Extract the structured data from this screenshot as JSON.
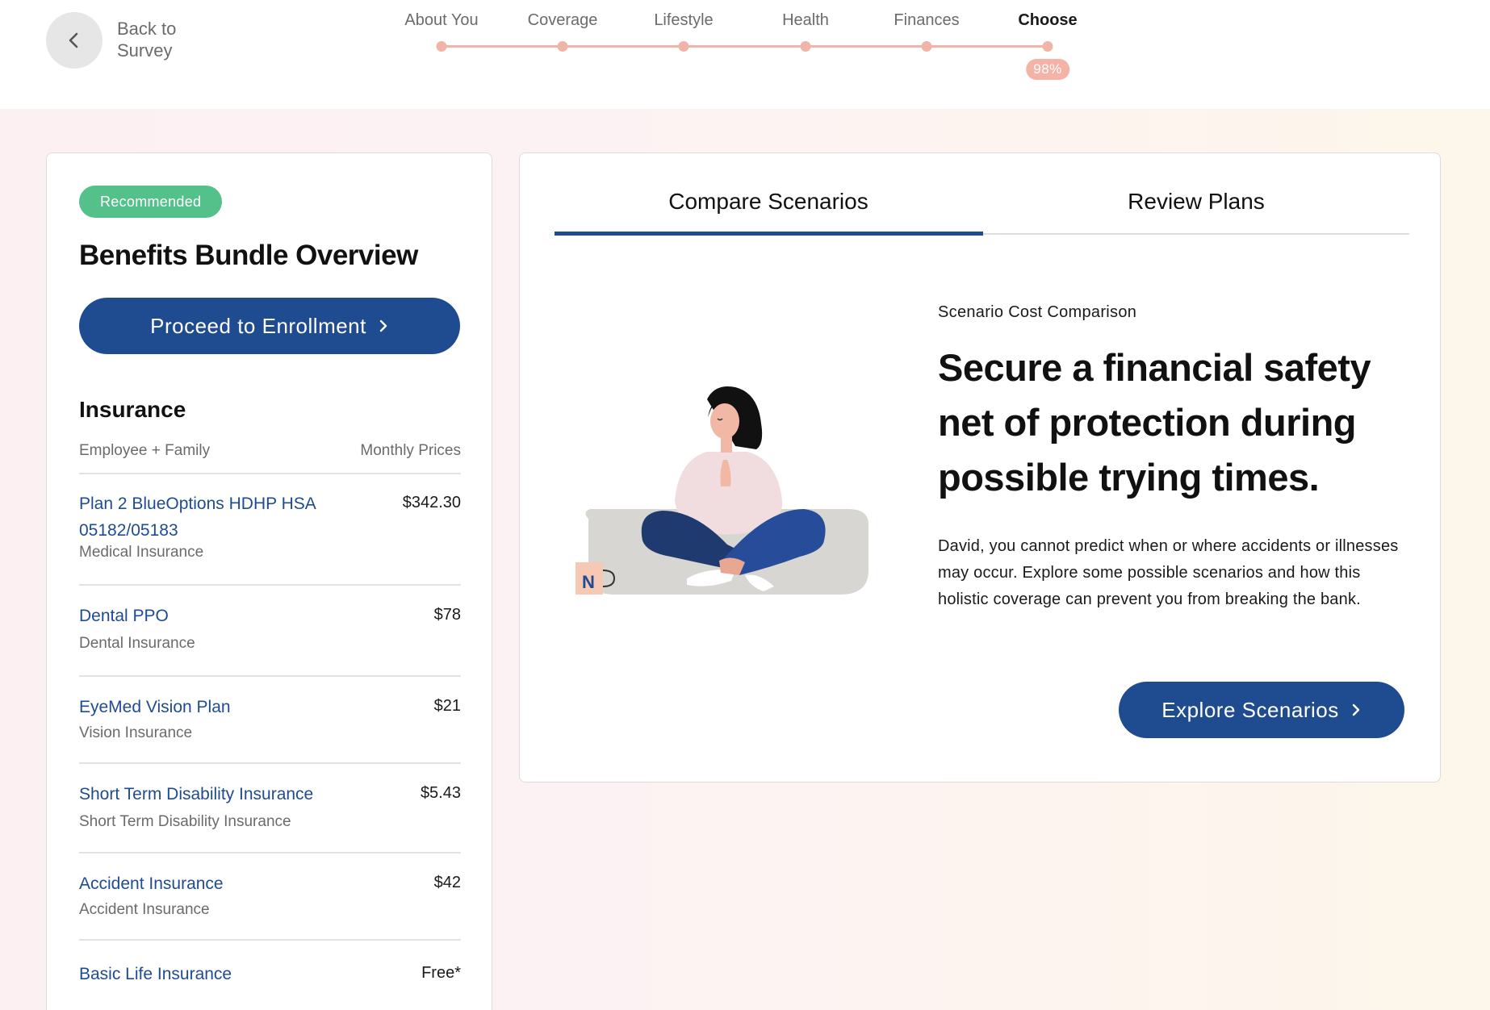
{
  "header": {
    "back_label": "Back to Survey",
    "back_icon": "chevron-left-icon",
    "steps": [
      {
        "label": "About You"
      },
      {
        "label": "Coverage"
      },
      {
        "label": "Lifestyle"
      },
      {
        "label": "Health"
      },
      {
        "label": "Finances"
      },
      {
        "label": "Choose",
        "active": true
      }
    ],
    "progress": "98%",
    "progress_value": 0.98,
    "progress_color": "#f0b4a8"
  },
  "bundle": {
    "badge": "Recommended",
    "badge_color": "#54c08a",
    "title": "Benefits Bundle Overview",
    "proceed_label": "Proceed to Enrollment",
    "accent_color": "#1f4b91",
    "insurance": {
      "heading": "Insurance",
      "coverage_tier": "Employee + Family",
      "price_header": "Monthly Prices",
      "plans": [
        {
          "name": "Plan 2 BlueOptions HDHP HSA 05182/05183",
          "type": "Medical Insurance",
          "price": "$342.30"
        },
        {
          "name": "Dental PPO",
          "type": "Dental Insurance",
          "price": "$78"
        },
        {
          "name": "EyeMed Vision Plan",
          "type": "Vision Insurance",
          "price": "$21"
        },
        {
          "name": "Short Term Disability Insurance",
          "type": "Short Term Disability Insurance",
          "price": "$5.43"
        },
        {
          "name": "Accident Insurance",
          "type": "Accident Insurance",
          "price": "$42"
        },
        {
          "name": "Basic Life Insurance",
          "type": "",
          "price": "Free*"
        }
      ]
    }
  },
  "scenarios": {
    "tabs": [
      {
        "label": "Compare Scenarios",
        "active": true
      },
      {
        "label": "Review Plans",
        "active": false
      }
    ],
    "eyebrow": "Scenario Cost Comparison",
    "headline": "Secure a financial safety net of protection during possible trying times.",
    "body": "David, you cannot predict when or where accidents or illnesses may occur. Explore some possible scenarios and how this holistic coverage can prevent you from breaking the bank.",
    "explore_label": "Explore Scenarios",
    "illustration": "meditating-woman-illustration",
    "mug_letter": "N"
  }
}
